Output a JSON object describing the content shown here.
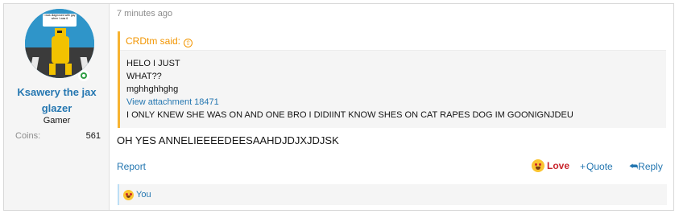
{
  "user": {
    "name": "Ksawery the jax glazer",
    "title": "Gamer",
    "avatar_caption": "I was diagnosed with gay when I was 6",
    "stats": [
      {
        "label": "Coins:",
        "value": "561"
      }
    ]
  },
  "post": {
    "timestamp": "7 minutes ago",
    "quote": {
      "author": "CRDtm said:",
      "lines": [
        "HELO I JUST",
        "WHAT??",
        "mghhghhghg"
      ],
      "attachment": "View attachment 18471",
      "last_line": "I ONLY KNEW SHE WAS ON AND ONE BRO I DIDIINT KNOW SHES ON CAT RAPES DOG IM GOONIGNJDEU"
    },
    "body": "OH YES ANNELIEEEEDEESAAHDJDJXJDJSK",
    "actions": {
      "report": "Report",
      "love": "Love",
      "quote": "Quote",
      "reply": "Reply"
    },
    "reactions_by": "You"
  },
  "colors": {
    "link": "#2577b1",
    "quote_accent": "#f7b331",
    "love": "#c8252c",
    "online": "#2f9e44"
  }
}
